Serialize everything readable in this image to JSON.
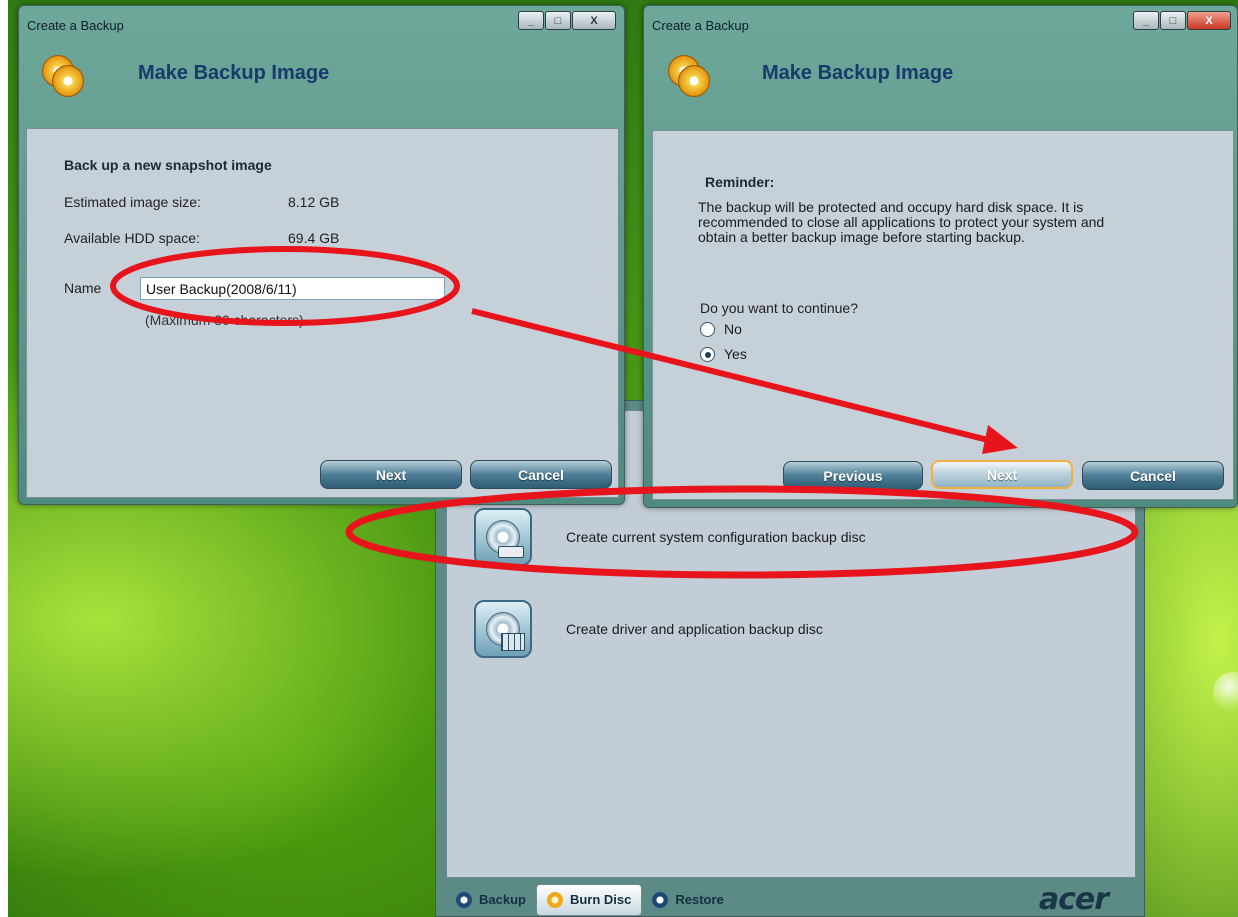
{
  "background_app": {
    "options": [
      {
        "label": "Create current system configuration backup disc",
        "icon": "backup-disc-icon"
      },
      {
        "label": "Create driver and application backup disc",
        "icon": "application-disc-icon"
      }
    ],
    "tabs": [
      {
        "label": "Backup",
        "icon": "backup-tab-icon"
      },
      {
        "label": "Burn Disc",
        "icon": "burn-disc-tab-icon",
        "active": true
      },
      {
        "label": "Restore",
        "icon": "restore-tab-icon"
      }
    ],
    "brand": "acer"
  },
  "dialog_left": {
    "window_title": "Create a Backup",
    "header_title": "Make Backup Image",
    "section_title": "Back up a new snapshot image",
    "estimated_label": "Estimated image size:",
    "estimated_value": "8.12 GB",
    "available_label": "Available HDD space:",
    "available_value": "69.4 GB",
    "name_label": "Name",
    "name_value": "User Backup(2008/6/11)",
    "hint": "(Maximum 30 characters)",
    "buttons": {
      "next": "Next",
      "cancel": "Cancel"
    }
  },
  "dialog_right": {
    "window_title": "Create a Backup",
    "header_title": "Make Backup Image",
    "reminder_title": "Reminder:",
    "reminder_lines": [
      "The backup will be protected and occupy hard disk space. It is",
      "recommended to close all applications to protect your system and",
      "obtain a better backup image before starting backup."
    ],
    "question": "Do you want to continue?",
    "options": [
      {
        "label": "No",
        "checked": false
      },
      {
        "label": "Yes",
        "checked": true
      }
    ],
    "buttons": {
      "previous": "Previous",
      "next": "Next",
      "cancel": "Cancel"
    }
  },
  "window_controls": {
    "minimize": "_",
    "maximize": "□",
    "close": "X"
  },
  "annotation_color": "#e8141b"
}
